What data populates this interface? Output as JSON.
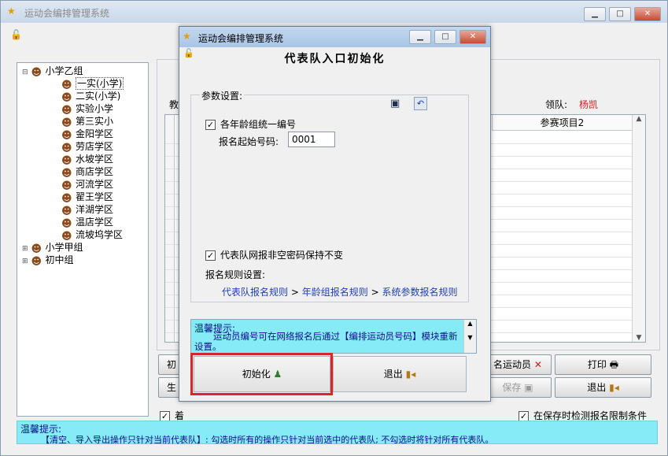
{
  "main": {
    "title": "运动会编排管理系统",
    "tree": {
      "root": "小学乙组",
      "children": [
        "一实(小学)",
        "二实(小学)",
        "实验小学",
        "第三实小",
        "金阳学区",
        "劳店学区",
        "水坡学区",
        "商店学区",
        "河流学区",
        "翟王学区",
        "洋湖学区",
        "温店学区",
        "流坡坞学区"
      ],
      "siblings": [
        "小学甲组",
        "初中组"
      ]
    },
    "label_coach": "教",
    "label_leader": "领队:",
    "leader_name": "杨凯",
    "grid_header_col": "参赛项目2",
    "partial_btn_1": "初",
    "partial_btn_2": "生",
    "btn_name_athlete": "名运动员",
    "btn_print": "打印",
    "btn_save": "保存",
    "btn_exit": "退出",
    "partial_check_text": "着",
    "check_save_limit": "在保存时检测报名限制条件",
    "tip_title": "温馨提示:",
    "tip_text": "【清空、导入导出操作只针对当前代表队】: 勾选时所有的操作只针对当前选中的代表队; 不勾选时将针对所有代表队。"
  },
  "dialog": {
    "title": "运动会编排管理系统",
    "heading": "代表队入口初始化",
    "group_label": "参数设置:",
    "check_unified_numbering": "各年龄组统一编号",
    "start_number_label": "报名起始号码:",
    "start_number_value": "0001",
    "check_keep_password": "代表队网报非空密码保持不变",
    "rules_label": "报名规则设置:",
    "rules_path": [
      "代表队报名规则",
      "年龄组报名规则",
      "系统参数报名规则"
    ],
    "rules_sep": ">",
    "tip_title": "温馨提示:",
    "tip_text": "运动员编号可在网络报名后通过【编排运动员号码】模块重新设置。",
    "btn_init": "初始化",
    "btn_exit": "退出"
  },
  "colors": {
    "leader_name": "#e02020",
    "tip_bg": "#87eaf7",
    "link": "#1f3dbd",
    "highlight_border": "#d9262a"
  }
}
